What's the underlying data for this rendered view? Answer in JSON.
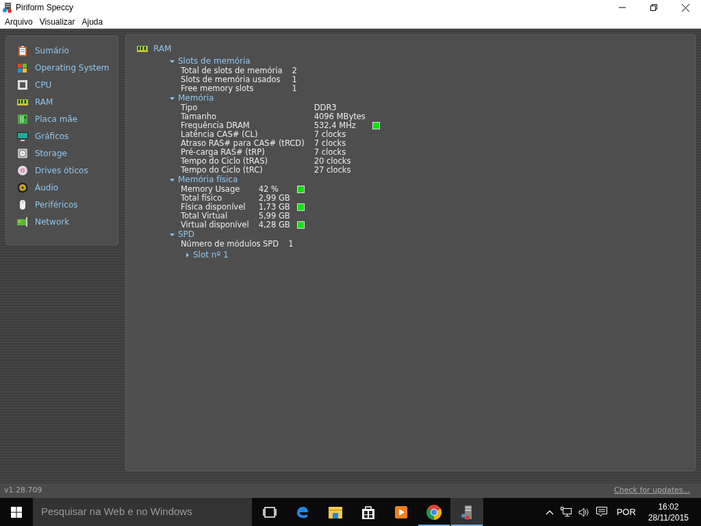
{
  "window": {
    "title": "Piriform Speccy"
  },
  "menu": [
    "Arquivo",
    "Visualizar",
    "Ajuda"
  ],
  "sidebar": {
    "items": [
      {
        "label": "Sumário"
      },
      {
        "label": "Operating System"
      },
      {
        "label": "CPU"
      },
      {
        "label": "RAM"
      },
      {
        "label": "Placa mãe"
      },
      {
        "label": "Gráficos"
      },
      {
        "label": "Storage"
      },
      {
        "label": "Drives óticos"
      },
      {
        "label": "Áudio"
      },
      {
        "label": "Periféricos"
      },
      {
        "label": "Network"
      }
    ]
  },
  "content": {
    "title": "RAM",
    "sections": [
      {
        "title": "Slots de memória",
        "expanded": true,
        "rows": [
          {
            "label": "Total de slots de memória",
            "value": "2",
            "indicator": false
          },
          {
            "label": "Slots de memória usados",
            "value": "1",
            "indicator": false
          },
          {
            "label": "Free memory slots",
            "value": "1",
            "indicator": false
          }
        ]
      },
      {
        "title": "Memória",
        "expanded": true,
        "rows": [
          {
            "label": "Tipo",
            "value": "DDR3",
            "indicator": false
          },
          {
            "label": "Tamanho",
            "value": "4096 MBytes",
            "indicator": false
          },
          {
            "label": "Frequência DRAM",
            "value": "532,4 MHz",
            "indicator": true
          },
          {
            "label": "Latência CAS# (CL)",
            "value": "7 clocks",
            "indicator": false
          },
          {
            "label": "Atraso RAS# para CAS# (tRCD)",
            "value": "7 clocks",
            "indicator": false
          },
          {
            "label": "Pré-carga RAS# (tRP)",
            "value": "7 clocks",
            "indicator": false
          },
          {
            "label": "Tempo do Ciclo (tRAS)",
            "value": "20 clocks",
            "indicator": false
          },
          {
            "label": "Tempo do Ciclo (tRC)",
            "value": "27 clocks",
            "indicator": false
          }
        ]
      },
      {
        "title": "Memória física",
        "expanded": true,
        "rows": [
          {
            "label": "Memory Usage",
            "value": "42 %",
            "indicator": true
          },
          {
            "label": "Total físico",
            "value": "2,99 GB",
            "indicator": false
          },
          {
            "label": "Física disponível",
            "value": "1,73 GB",
            "indicator": true
          },
          {
            "label": "Total Virtual",
            "value": "5,99 GB",
            "indicator": false
          },
          {
            "label": "Virtual disponível",
            "value": "4,28 GB",
            "indicator": true
          }
        ]
      },
      {
        "title": "SPD",
        "expanded": true,
        "rows": [
          {
            "label": "Número de módulos SPD",
            "value": "1",
            "indicator": false
          }
        ],
        "children": [
          {
            "title": "Slot nº 1",
            "expanded": false
          }
        ]
      }
    ]
  },
  "status_bar": {
    "version": "v1.28.709",
    "link": "Check for updates..."
  },
  "taskbar": {
    "search": {
      "placeholder": "Pesquisar na Web e no Windows"
    },
    "apps": [
      {
        "running": false,
        "active": false
      },
      {
        "running": false,
        "active": false
      },
      {
        "running": false,
        "active": false
      },
      {
        "running": false,
        "active": false
      },
      {
        "running": false,
        "active": false
      },
      {
        "running": true,
        "active": false
      },
      {
        "running": true,
        "active": true
      }
    ],
    "language": "POR",
    "time": "16:02",
    "date": "28/11/2015"
  }
}
